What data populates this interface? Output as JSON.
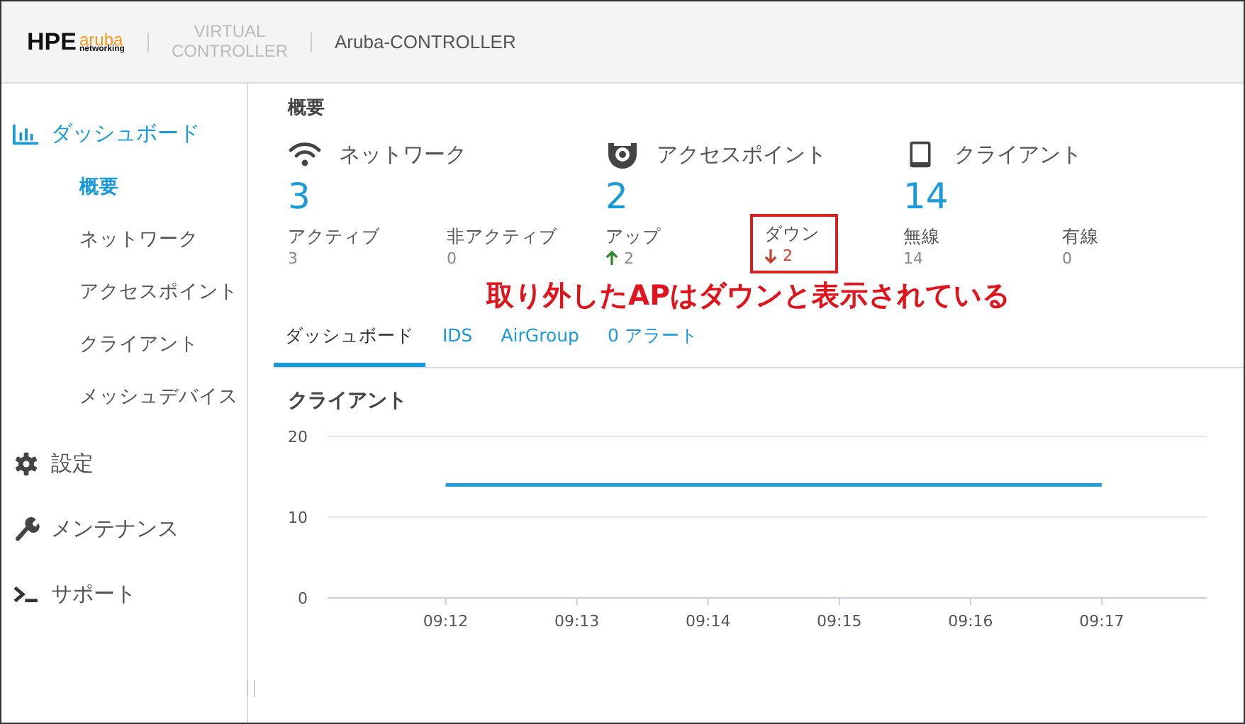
{
  "header": {
    "logo_main": "HPE",
    "logo_sub": "aruba",
    "logo_sub2": "networking",
    "product": [
      "VIRTUAL",
      "CONTROLLER"
    ],
    "name": "Aruba-CONTROLLER"
  },
  "sidebar": {
    "items": [
      {
        "label": "ダッシュボード",
        "kind": "chart",
        "selected": true,
        "children": [
          {
            "label": "概要",
            "selected": true
          },
          {
            "label": "ネットワーク",
            "selected": false
          },
          {
            "label": "アクセスポイント",
            "selected": false
          },
          {
            "label": "クライアント",
            "selected": false
          },
          {
            "label": "メッシュデバイス",
            "selected": false
          }
        ]
      },
      {
        "label": "設定",
        "kind": "gear",
        "selected": false
      },
      {
        "label": "メンテナンス",
        "kind": "wrench",
        "selected": false
      },
      {
        "label": "サポート",
        "kind": "terminal",
        "selected": false
      }
    ]
  },
  "overview": {
    "title": "概要",
    "groups": [
      {
        "kind": "wifi",
        "title": "ネットワーク",
        "count": "3",
        "stats": [
          {
            "kind": "plain",
            "label": "アクティブ",
            "value": "3",
            "highlighted": false
          },
          {
            "kind": "plain",
            "label": "非アクティブ",
            "value": "0",
            "highlighted": false
          }
        ]
      },
      {
        "kind": "ap",
        "title": "アクセスポイント",
        "count": "2",
        "stats": [
          {
            "kind": "up",
            "label": "アップ",
            "value": "2",
            "highlighted": false
          },
          {
            "kind": "down",
            "label": "ダウン",
            "value": "2",
            "highlighted": true
          }
        ]
      },
      {
        "kind": "tablet",
        "title": "クライアント",
        "count": "14",
        "stats": [
          {
            "kind": "plain",
            "label": "無線",
            "value": "14",
            "highlighted": false
          },
          {
            "kind": "plain",
            "label": "有線",
            "value": "0",
            "highlighted": false
          }
        ]
      }
    ],
    "annotation": "取り外したAPはダウンと表示されている"
  },
  "tabs": [
    {
      "label": "ダッシュボード",
      "selected": true
    },
    {
      "label": "IDS",
      "selected": false
    },
    {
      "label": "AirGroup",
      "selected": false
    },
    {
      "label": "0 アラート",
      "selected": false
    }
  ],
  "clients_panel": {
    "title": "クライアント",
    "chart_data": {
      "type": "line",
      "categories": [
        "09:12",
        "09:13",
        "09:14",
        "09:15",
        "09:16",
        "09:17"
      ],
      "series": [
        {
          "color": "#1fa0d8",
          "values": [
            14,
            14,
            14,
            14,
            14,
            14
          ]
        }
      ],
      "ylim": [
        0,
        20
      ],
      "yticks": [
        0,
        10,
        20
      ]
    }
  }
}
